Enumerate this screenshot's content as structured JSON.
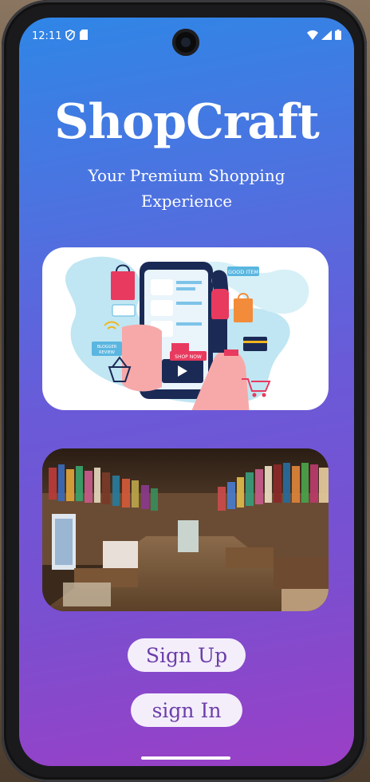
{
  "status_bar": {
    "time": "12:11"
  },
  "app": {
    "title": "ShopCraft",
    "subtitle": "Your Premium Shopping Experience"
  },
  "illustration": {
    "tag_good_item": "GOOD ITEM",
    "tag_blogger": "BLOGGER REVIEW",
    "tag_shop_now": "SHOP NOW"
  },
  "buttons": {
    "sign_up": "Sign Up",
    "sign_in": "sign In"
  },
  "colors": {
    "gradient_top": "#2f86e6",
    "gradient_bottom": "#9b3fc6",
    "button_bg": "#f4eefb",
    "button_text": "#6b3ea8"
  }
}
